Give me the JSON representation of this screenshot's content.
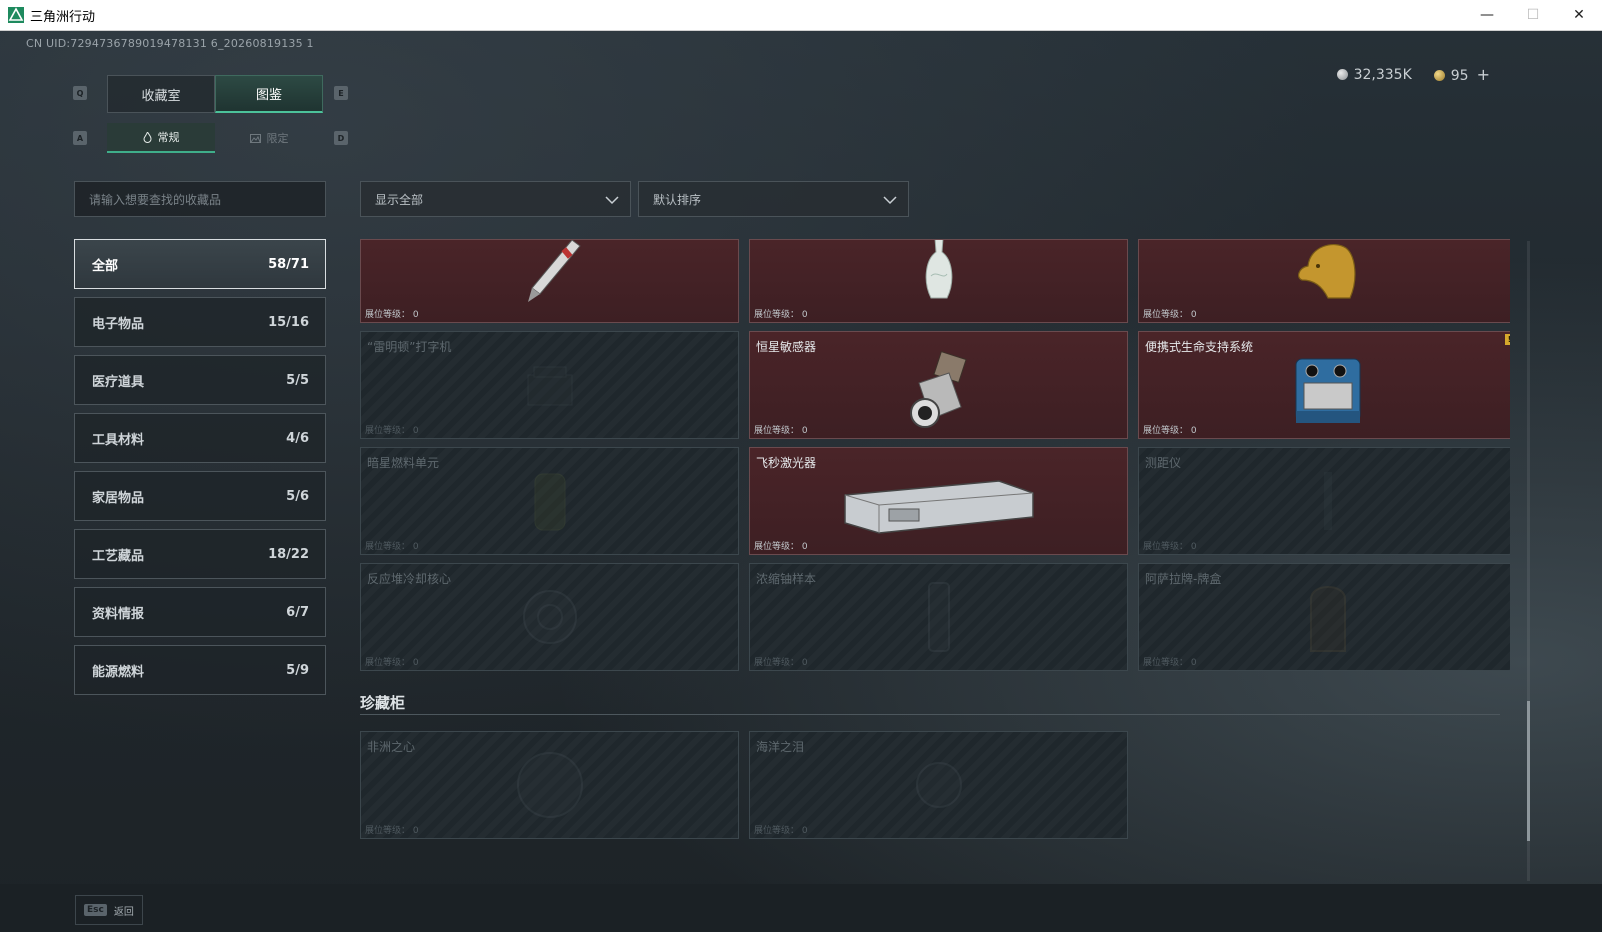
{
  "window": {
    "title": "三角洲行动",
    "brand_color": "#1e8a5e"
  },
  "uid_text": "CN UID:7294736789019478131 6_20260819135 1",
  "currency": {
    "silver": "32,335K",
    "gold": "95",
    "plus_label": "+"
  },
  "keys": {
    "prev_main": "Q",
    "next_main": "E",
    "prev_sub": "A",
    "next_sub": "D"
  },
  "main_tabs": [
    {
      "label": "收藏室",
      "active": false
    },
    {
      "label": "图鉴",
      "active": true
    }
  ],
  "sub_tabs": [
    {
      "label": "常规",
      "icon": "flame-icon",
      "active": true
    },
    {
      "label": "限定",
      "icon": "image-icon",
      "active": false
    }
  ],
  "search": {
    "placeholder": "请输入想要查找的收藏品",
    "value": ""
  },
  "filters": {
    "show": "显示全部",
    "sort": "默认排序"
  },
  "categories": [
    {
      "label": "全部",
      "count": "58/71",
      "active": true
    },
    {
      "label": "电子物品",
      "count": "15/16"
    },
    {
      "label": "医疗道具",
      "count": "5/5"
    },
    {
      "label": "工具材料",
      "count": "4/6"
    },
    {
      "label": "家居物品",
      "count": "5/6"
    },
    {
      "label": "工艺藏品",
      "count": "18/22"
    },
    {
      "label": "资料情报",
      "count": "6/7"
    },
    {
      "label": "能源燃料",
      "count": "5/9"
    }
  ],
  "level_prefix": "展位等级：",
  "cards": [
    {
      "name": "",
      "level": "0",
      "owned": true,
      "icon": "fountain-pen-icon"
    },
    {
      "name": "",
      "level": "0",
      "owned": true,
      "icon": "porcelain-vase-icon"
    },
    {
      "name": "",
      "level": "0",
      "owned": true,
      "icon": "golden-horse-head-icon"
    },
    {
      "name": "“雷明顿”打字机",
      "level": "0",
      "owned": false,
      "icon": "typewriter-icon"
    },
    {
      "name": "恒星敏感器",
      "level": "0",
      "owned": true,
      "icon": "star-sensor-icon"
    },
    {
      "name": "便携式生命支持系统",
      "level": "0",
      "owned": true,
      "icon": "life-support-icon",
      "badge": "!"
    },
    {
      "name": "暗星燃料单元",
      "level": "0",
      "owned": false,
      "icon": "fuel-cell-icon"
    },
    {
      "name": "飞秒激光器",
      "level": "0",
      "owned": true,
      "icon": "laser-device-icon"
    },
    {
      "name": "测距仪",
      "level": "0",
      "owned": false,
      "icon": "rangefinder-icon"
    },
    {
      "name": "反应堆冷却核心",
      "level": "0",
      "owned": false,
      "icon": "reactor-core-icon"
    },
    {
      "name": "浓缩铀样本",
      "level": "0",
      "owned": false,
      "icon": "uranium-sample-icon"
    },
    {
      "name": "阿萨拉牌-牌盒",
      "level": "0",
      "owned": false,
      "icon": "card-box-icon"
    }
  ],
  "treasure_section": {
    "title": "珍藏柜",
    "cards": [
      {
        "name": "非洲之心",
        "level": "0",
        "owned": false,
        "icon": "gem-icon"
      },
      {
        "name": "海洋之泪",
        "level": "0",
        "owned": false,
        "icon": "pearl-icon"
      }
    ]
  },
  "footer": {
    "esc_key": "Esc",
    "back_label": "返回"
  }
}
